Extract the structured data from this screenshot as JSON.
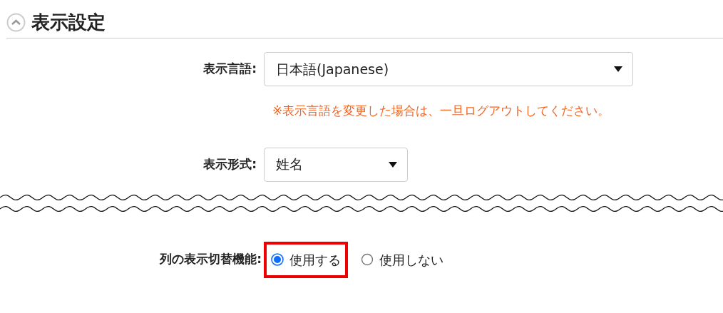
{
  "section": {
    "title": "表示設定",
    "expanded": true
  },
  "fields": [
    {
      "kind": "select",
      "label": "表示言語:",
      "value": "日本語(Japanese)",
      "note": "※表示言語を変更した場合は、一旦ログアウトしてください。",
      "wide": true
    },
    {
      "kind": "select",
      "label": "表示形式:",
      "value": "姓名",
      "wide": false
    },
    {
      "kind": "break"
    },
    {
      "kind": "radio",
      "label": "列の表示切替機能:",
      "options": [
        {
          "label": "使用する",
          "selected": true,
          "highlighted": true
        },
        {
          "label": "使用しない",
          "selected": false,
          "highlighted": false
        }
      ]
    }
  ]
}
